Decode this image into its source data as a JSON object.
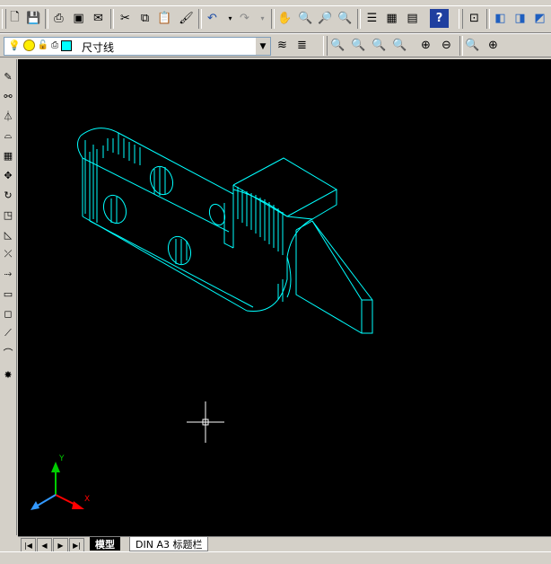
{
  "toolbar_top": {
    "icons": [
      "new-icon",
      "open-icon",
      "save-icon",
      "print-icon",
      "plot-preview-icon",
      "publish-icon",
      "cut-icon",
      "copy-icon",
      "paste-icon",
      "match-properties-icon",
      "undo-icon",
      "undo-dropdown-icon",
      "redo-icon",
      "redo-dropdown-icon",
      "pan-icon",
      "zoom-realtime-icon",
      "zoom-window-icon",
      "zoom-previous-icon",
      "properties-icon",
      "design-center-icon",
      "tool-palettes-icon",
      "help-icon",
      "ucs-icon",
      "view-top-icon",
      "view-front-icon",
      "view-iso-icon"
    ]
  },
  "layer_bar": {
    "layer_name": "尺寸线",
    "colors": {
      "bulb": "#ffff00",
      "sun": "#ffee00",
      "layer_color": "#00ffff"
    }
  },
  "zoom_toolbar": {
    "icons": [
      "zoom-window-icon",
      "zoom-dynamic-icon",
      "zoom-scale-icon",
      "zoom-center-icon",
      "zoom-in-icon",
      "zoom-out-icon",
      "zoom-all-icon",
      "zoom-extents-icon"
    ]
  },
  "left_toolbar": {
    "icons": [
      "erase-icon",
      "copy-object-icon",
      "mirror-icon",
      "offset-icon",
      "array-icon",
      "move-icon",
      "rotate-icon",
      "scale-icon",
      "stretch-icon",
      "trim-icon",
      "extend-icon",
      "break-icon",
      "join-icon",
      "chamfer-icon",
      "fillet-icon",
      "explode-icon"
    ]
  },
  "ucs": {
    "x_label": "X",
    "y_label": "Y",
    "x_color": "#ff0000",
    "y_color": "#00cc00",
    "z_color": "#3399ff"
  },
  "drawing": {
    "line_color": "#00ffff"
  },
  "tabs": {
    "model": "模型",
    "layout": "DIN A3 标题栏"
  },
  "nav_buttons": [
    "|◀",
    "◀",
    "▶",
    "▶|"
  ]
}
